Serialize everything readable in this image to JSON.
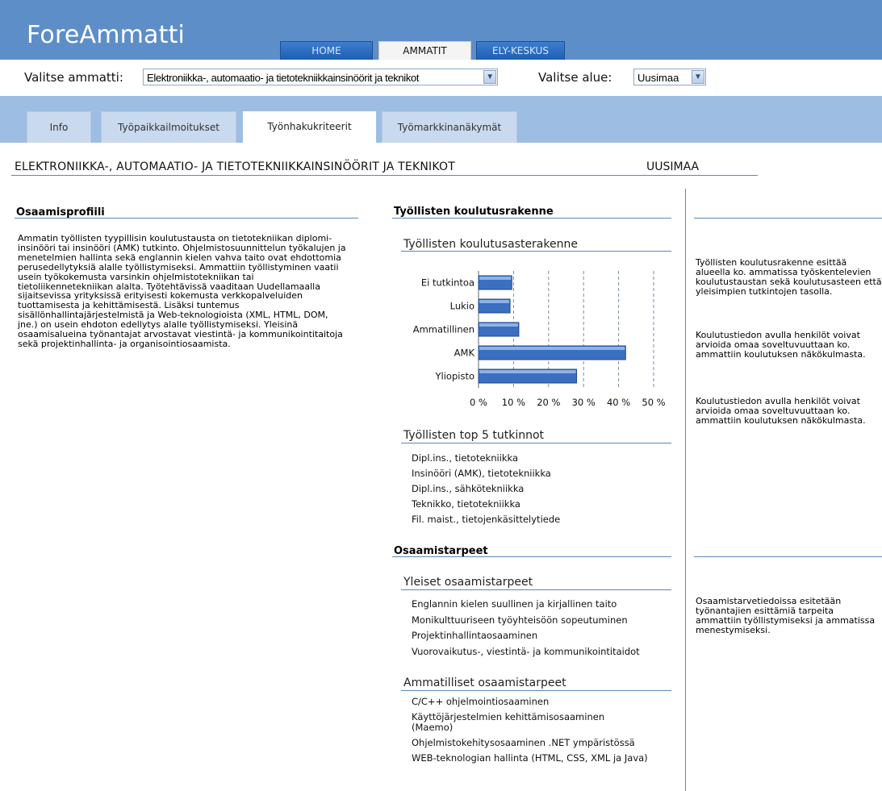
{
  "app": {
    "logo": "ForeAmmatti",
    "nav": [
      "HOME",
      "AMMATIT",
      "ELY-KESKUS"
    ]
  },
  "filters": {
    "occupation_label": "Valitse ammatti:",
    "occupation_value": "Elektroniikka-, automaatio- ja tietotekniikkainsinöörit ja teknikot",
    "region_label": "Valitse alue:",
    "region_value": "Uusimaa"
  },
  "tabs": [
    "Info",
    "Työpaikkailmoitukset",
    "Työnhakukriteerit",
    "Työmarkkinanäkymät"
  ],
  "page": {
    "title": "ELEKTRONIIKKA-, AUTOMAATIO- JA TIETOTEKNIIKKAINSINÖÖRIT JA TEKNIKOT",
    "region": "UUSIMAA"
  },
  "profile": {
    "title": "Osaamisprofiili",
    "text": "Ammatin työllisten tyypillisin koulutustausta on tietotekniikan diplomi-insinööri tai insinööri (AMK) tutkinto. Ohjelmistosuunnittelun työkalujen ja menetelmien hallinta sekä englannin kielen vahva taito ovat ehdottomia perusedellytyksiä alalle työllistymiseksi. Ammattiin työllistyminen vaatii usein työkokemusta varsinkin ohjelmistotekniikan tai tietoliikennetekniikan alalta. Työtehtävissä vaaditaan Uudellamaalla sijaitsevissa yrityksissä erityisesti kokemusta verkkopalveluiden tuottamisesta ja kehittämisestä. Lisäksi tuntemus sisällönhallintajärjestelmistä ja Web-teknologioista (XML, HTML, DOM, jne.) on usein ehdoton edellytys alalle työllistymiseksi. Yleisinä osaamisalueina työnantajat arvostavat viestintä- ja kommunikointitaitoja sekä projektinhallinta- ja organisointiosaamista."
  },
  "education": {
    "title": "Työllisten koulutusrakenne",
    "chart_title": "Työllisten koulutusasterakenne",
    "top5_title": "Työllisten top 5 tutkinnot",
    "top5": [
      "Dipl.ins., tietotekniikka",
      "Insinööri (AMK), tietotekniikka",
      "Dipl.ins., sähkötekniikka",
      "Teknikko, tietotekniikka",
      "Fil. maist., tietojenkäsittelytiede"
    ]
  },
  "chart_data": {
    "type": "bar",
    "orientation": "horizontal",
    "title": "Työllisten koulutusasterakenne",
    "categories": [
      "Ei tutkintoa",
      "Lukio",
      "Ammatillinen",
      "AMK",
      "Yliopisto"
    ],
    "values": [
      9.5,
      9,
      11.5,
      42,
      28
    ],
    "xlim": [
      0,
      50
    ],
    "xticks": [
      "0 %",
      "10 %",
      "20 %",
      "30 %",
      "40 %",
      "50 %"
    ],
    "grid": "vertical dashed",
    "bar_color": "#3b6fc0"
  },
  "needs": {
    "title": "Osaamistarpeet",
    "general_title": "Yleiset osaamistarpeet",
    "general": [
      "Englannin kielen suullinen ja kirjallinen taito",
      "Monikulttuuriseen työyhteisöön sopeutuminen",
      "Projektinhallintaosaaminen",
      "Vuorovaikutus-, viestintä- ja kommunikointitaidot"
    ],
    "professional_title": "Ammatilliset osaamistarpeet",
    "professional": [
      "C/C++ ohjelmointiosaaminen",
      "Käyttöjärjestelmien kehittämisosaaminen (Maemo)",
      "Ohjelmistokehitysosaaminen .NET ympäristössä",
      "WEB-teknologian hallinta (HTML, CSS, XML ja Java)"
    ]
  },
  "sidebar": {
    "p1": "Työllisten koulutusrakenne esittää alueella ko. ammatissa työskentelevien koulutustaustan sekä koulutusasteen että yleisimpien tutkintojen tasolla.",
    "p2": "Koulutustiedon avulla henkilöt voivat arvioida omaa soveltuvuuttaan ko. ammattiin koulutuksen näkökulmasta.",
    "p3": "Koulutustiedon avulla henkilöt voivat arvioida omaa soveltuvuuttaan ko. ammattiin koulutuksen näkökulmasta.",
    "p4": "Osaamistarvetiedoissa esitetään työnantajien esittämiä tarpeita ammattiin työllistymiseksi ja ammatissa menestymiseksi."
  }
}
